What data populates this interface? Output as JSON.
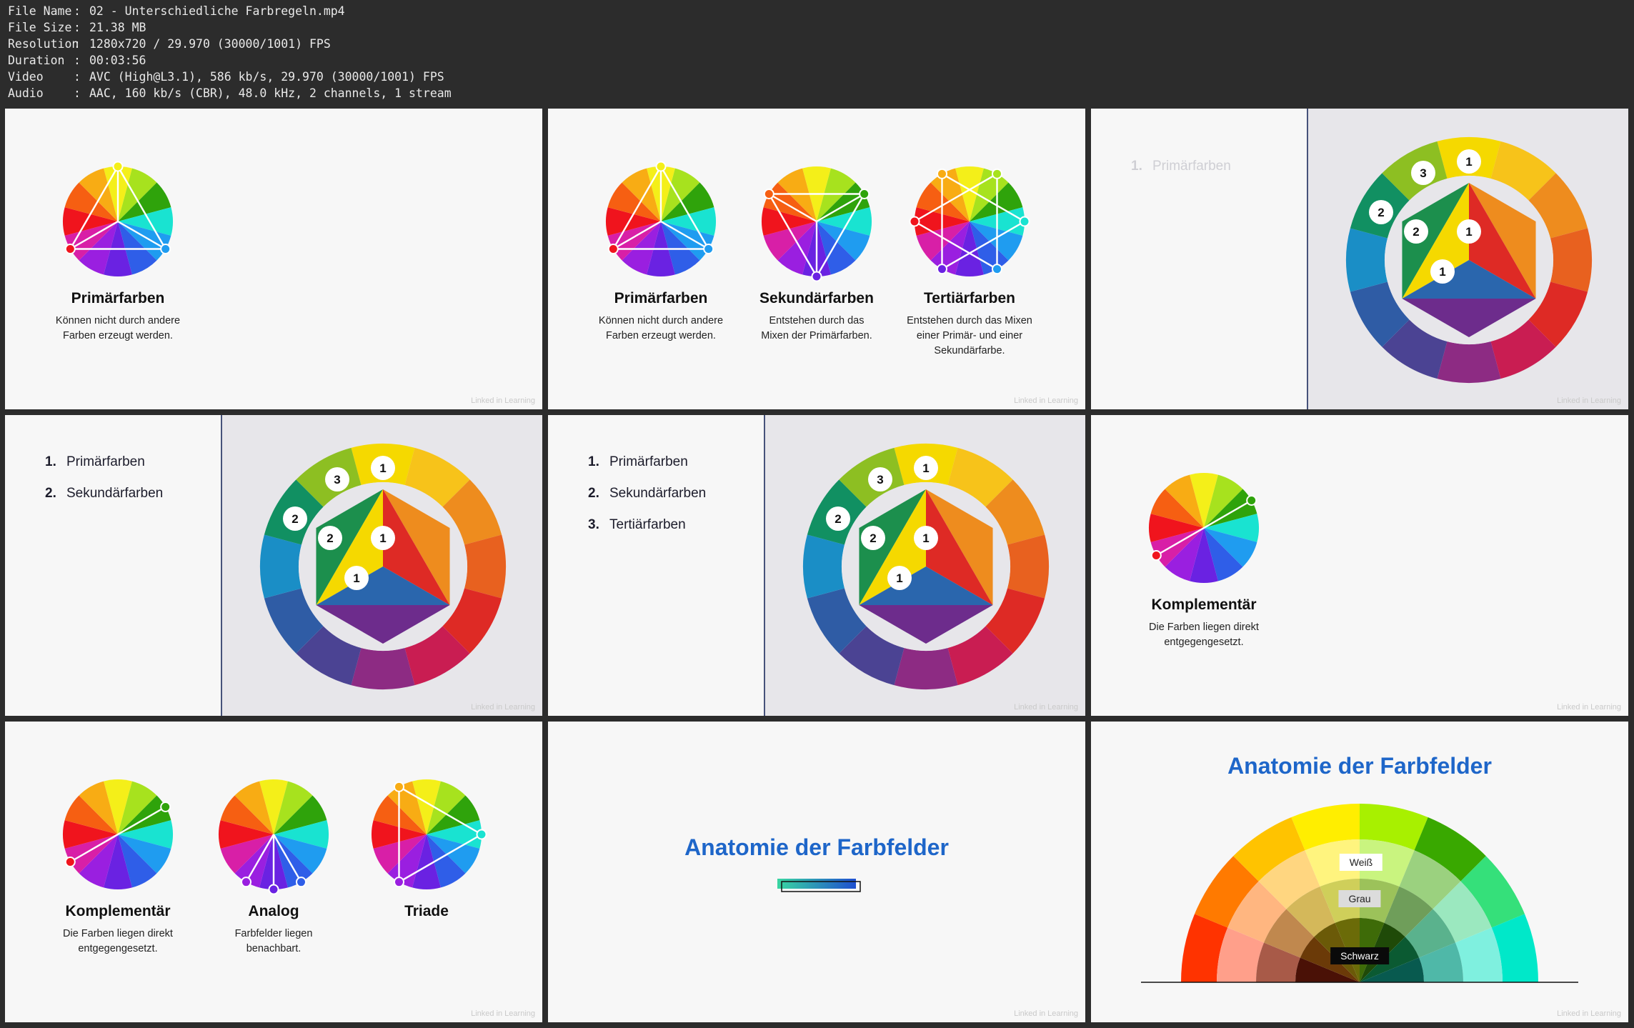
{
  "meta": {
    "rows": [
      {
        "label": "File Name",
        "value": "02 - Unterschiedliche Farbregeln.mp4"
      },
      {
        "label": "File Size",
        "value": "21.38 MB"
      },
      {
        "label": "Resolution",
        "value": "1280x720 / 29.970 (30000/1001) FPS"
      },
      {
        "label": "Duration",
        "value": "00:03:56"
      },
      {
        "label": "Video",
        "value": "AVC (High@L3.1), 586 kb/s, 29.970 (30000/1001) FPS"
      },
      {
        "label": "Audio",
        "value": "AAC, 160 kb/s (CBR), 48.0 kHz, 2 channels, 1 stream"
      }
    ],
    "separator": ":"
  },
  "watermark": "Linked in Learning",
  "colors": {
    "accent_blue": "#1e66c9",
    "panel_bg": "#e7e6ea",
    "tile_bg": "#f7f7f7"
  },
  "tiles": {
    "t1": {
      "title": "Primärfarben",
      "desc": "Können nicht durch andere\nFarben erzeugt werden."
    },
    "t2": {
      "items": [
        {
          "title": "Primärfarben",
          "desc": "Können nicht durch andere\nFarben erzeugt werden."
        },
        {
          "title": "Sekundärfarben",
          "desc": "Entstehen durch das\nMixen der Primärfarben."
        },
        {
          "title": "Tertiärfarben",
          "desc": "Entstehen durch das Mixen\neiner Primär- und einer\nSekundärfarbe."
        }
      ]
    },
    "t3": {
      "list": [
        {
          "num": "1.",
          "label": "Primärfarben"
        }
      ]
    },
    "t4": {
      "list": [
        {
          "num": "1.",
          "label": "Primärfarben"
        },
        {
          "num": "2.",
          "label": "Sekundärfarben"
        }
      ]
    },
    "t5": {
      "list": [
        {
          "num": "1.",
          "label": "Primärfarben"
        },
        {
          "num": "2.",
          "label": "Sekundärfarben"
        },
        {
          "num": "3.",
          "label": "Tertiärfarben"
        }
      ]
    },
    "t6": {
      "title": "Komplementär",
      "desc": "Die Farben liegen direkt\nentgegengesetzt."
    },
    "t7": {
      "items": [
        {
          "title": "Komplementär",
          "desc": "Die Farben liegen direkt\nentgegengesetzt."
        },
        {
          "title": "Analog",
          "desc": "Farbfelder liegen\nbenachbart."
        },
        {
          "title": "Triade",
          "desc": ""
        }
      ]
    },
    "t8": {
      "title": "Anatomie der Farbfelder"
    },
    "t9": {
      "title": "Anatomie der Farbfelder",
      "chips": {
        "white": "Weiß",
        "gray": "Grau",
        "black": "Schwarz"
      }
    }
  },
  "badges": {
    "one": "1",
    "two": "2",
    "three": "3"
  }
}
